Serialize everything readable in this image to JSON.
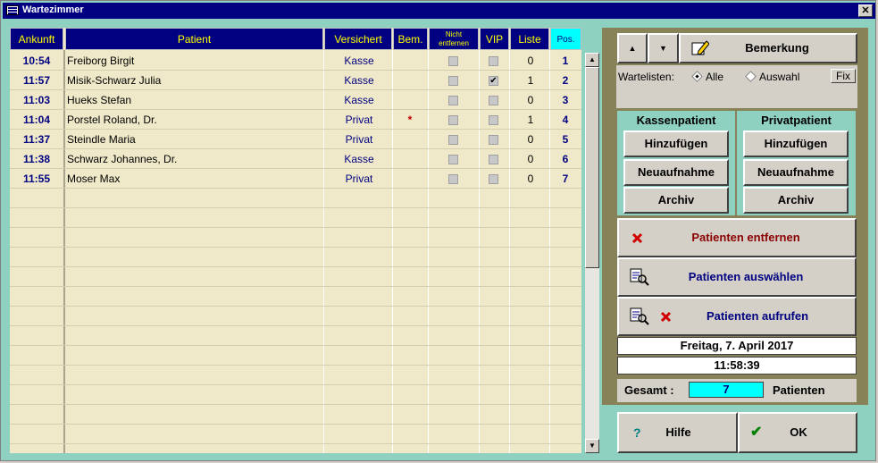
{
  "window": {
    "title": "Wartezimmer",
    "close_glyph": "✕"
  },
  "columns": {
    "ankunft": "Ankunft",
    "patient": "Patient",
    "versichert": "Versichert",
    "bem": "Bem.",
    "nicht_line1": "Nicht",
    "nicht_line2": "entfernen",
    "vip": "VIP",
    "liste": "Liste",
    "pos": "Pos."
  },
  "rows": [
    {
      "time": "10:54",
      "name": "Freiborg Birgit",
      "ins": "Kasse",
      "bem": "",
      "vip": "",
      "liste": "0",
      "pos": "1"
    },
    {
      "time": "11:57",
      "name": "Misik-Schwarz Julia",
      "ins": "Kasse",
      "bem": "",
      "vip": "✔",
      "liste": "1",
      "pos": "2"
    },
    {
      "time": "11:03",
      "name": "Hueks Stefan",
      "ins": "Kasse",
      "bem": "",
      "vip": "",
      "liste": "0",
      "pos": "3"
    },
    {
      "time": "11:04",
      "name": "Porstel Roland, Dr.",
      "ins": "Privat",
      "bem": "*",
      "vip": "",
      "liste": "1",
      "pos": "4"
    },
    {
      "time": "11:37",
      "name": "Steindle Maria",
      "ins": "Privat",
      "bem": "",
      "vip": "",
      "liste": "0",
      "pos": "5"
    },
    {
      "time": "11:38",
      "name": "Schwarz Johannes, Dr.",
      "ins": "Kasse",
      "bem": "",
      "vip": "",
      "liste": "0",
      "pos": "6"
    },
    {
      "time": "11:55",
      "name": "Moser Max",
      "ins": "Privat",
      "bem": "",
      "vip": "",
      "liste": "0",
      "pos": "7"
    }
  ],
  "toolbar": {
    "up": "▲",
    "down": "▼",
    "bemerkung": "Bemerkung"
  },
  "wartelisten": {
    "label": "Wartelisten:",
    "alle": "Alle",
    "auswahl": "Auswahl",
    "fix": "Fix"
  },
  "kassen": {
    "head": "Kassenpatient",
    "add": "Hinzufügen",
    "neu": "Neuaufnahme",
    "archiv": "Archiv"
  },
  "privat": {
    "head": "Privatpatient",
    "add": "Hinzufügen",
    "neu": "Neuaufnahme",
    "archiv": "Archiv"
  },
  "actions": {
    "entfernen": "Patienten entfernen",
    "auswaehlen": "Patienten auswählen",
    "aufrufen": "Patienten aufrufen"
  },
  "status": {
    "date": "Freitag, 7. April 2017",
    "time": "11:58:39",
    "gesamt_label": "Gesamt :",
    "gesamt_value": "7",
    "gesamt_unit": "Patienten"
  },
  "footer": {
    "help_glyph": "?",
    "help": "Hilfe",
    "ok_glyph": "✔",
    "ok": "OK"
  },
  "colors": {
    "background": "#8fd1c1",
    "header": "#000080",
    "header_text": "#ffff00",
    "grid_bg": "#efe9c9",
    "panel": "#878258",
    "pos_header": "#00ffff",
    "remove_red": "#8b0000",
    "action_blue": "#000080"
  }
}
